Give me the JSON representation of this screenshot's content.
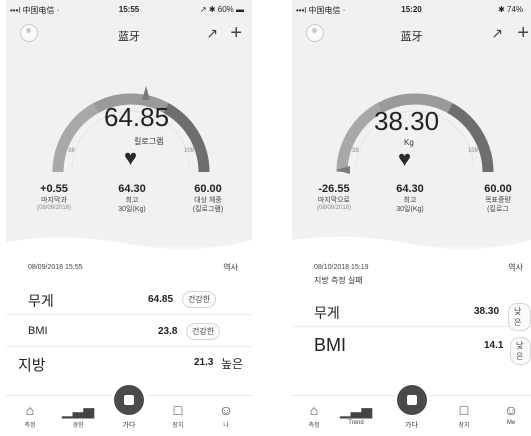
{
  "screens": [
    {
      "status": {
        "carrier": "•••l 中国电信 ⋅",
        "time": "15:55",
        "battery": "↗ ✱ 60% ▬"
      },
      "nav": {
        "title": "蓝牙",
        "share_icon": "share-icon",
        "add_icon": "plus-icon"
      },
      "gauge": {
        "weight": "64.85",
        "unit": "킬로그램",
        "range_low": "38",
        "range_high": "109"
      },
      "stats": [
        {
          "value": "+0.55",
          "label": "마지막과",
          "sub": "(08/09/2018)"
        },
        {
          "value": "64.30",
          "label": "최고\n30일(Kg)",
          "sub": ""
        },
        {
          "value": "60.00",
          "label": "대상 체중\n(킬로그램)",
          "sub": ""
        }
      ],
      "record": {
        "datetime": "08/09/2018 15:55",
        "history": "역사",
        "note": ""
      },
      "metrics": [
        {
          "name": "무게",
          "value": "64.85",
          "status": "건강한"
        },
        {
          "name": "BMI",
          "value": "23.8",
          "status": "건강한"
        },
        {
          "name": "지방",
          "value": "21.3",
          "status": "높은"
        }
      ],
      "tabs": [
        {
          "label": "측정",
          "icon": "home-icon"
        },
        {
          "label": "경향",
          "icon": "trend-icon"
        },
        {
          "label": "가다",
          "icon": "go-icon"
        },
        {
          "label": "장치",
          "icon": "device-icon"
        },
        {
          "label": "나",
          "icon": "smile-icon"
        }
      ]
    },
    {
      "status": {
        "carrier": "•••l 中国电信 ⋅",
        "time": "15:20",
        "battery": "✱ 74%"
      },
      "nav": {
        "title": "蓝牙",
        "share_icon": "share-icon",
        "add_icon": "plus-icon"
      },
      "gauge": {
        "weight": "38.30",
        "unit": "Kg",
        "range_low": "38",
        "range_high": "109"
      },
      "stats": [
        {
          "value": "-26.55",
          "label": "마지막으로",
          "sub": "(08/09/2018)"
        },
        {
          "value": "64.30",
          "label": "최고\n30일(Kg)",
          "sub": ""
        },
        {
          "value": "60.00",
          "label": "목표중량\n(킬로그",
          "sub": ""
        }
      ],
      "record": {
        "datetime": "08/10/2018 15:19",
        "history": "역사",
        "note": "지방 측정 실패"
      },
      "metrics": [
        {
          "name": "무게",
          "value": "38.30",
          "status": "낮은"
        },
        {
          "name": "BMI",
          "value": "14.1",
          "status": "낮은"
        }
      ],
      "tabs": [
        {
          "label": "측정",
          "icon": "home-icon"
        },
        {
          "label": "Trend",
          "icon": "trend-icon"
        },
        {
          "label": "가다",
          "icon": "go-icon"
        },
        {
          "label": "장치",
          "icon": "device-icon"
        },
        {
          "label": "Me",
          "icon": "smile-icon"
        }
      ]
    }
  ]
}
